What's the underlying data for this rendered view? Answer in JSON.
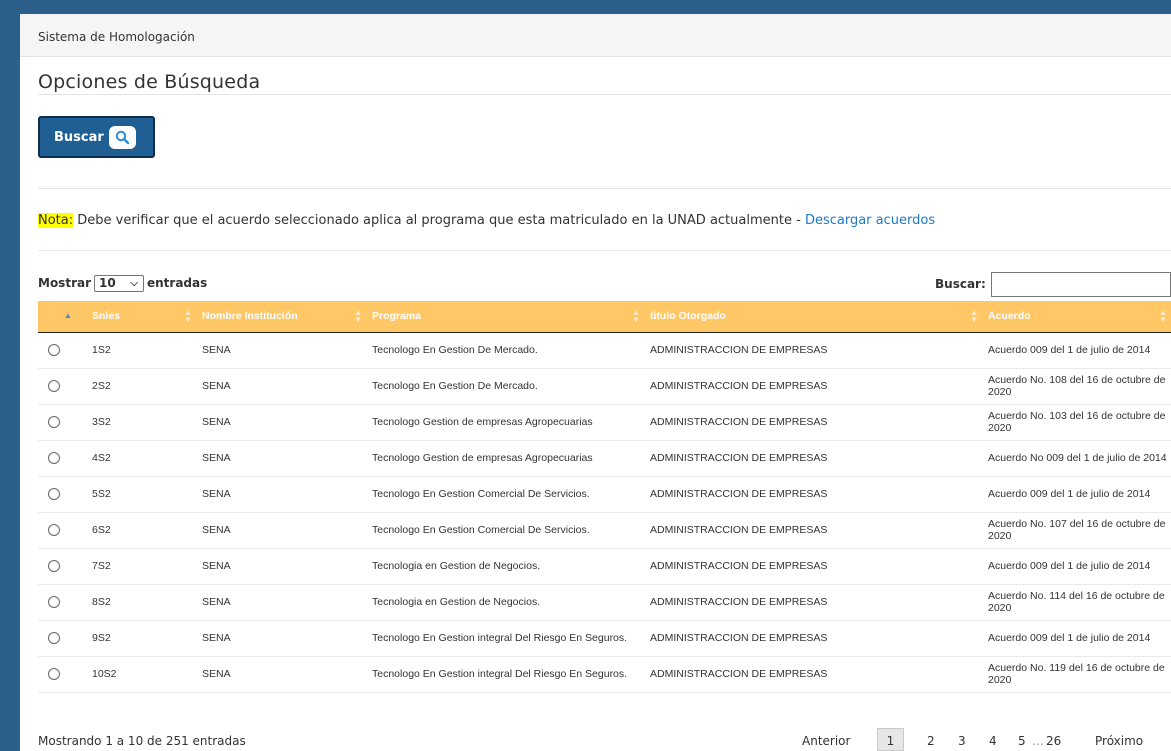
{
  "breadcrumb": "Sistema de Homologación",
  "page_title": "Opciones de Búsqueda",
  "search_button_label": "Buscar",
  "nota": {
    "tag": "Nota:",
    "text": " Debe verificar que el acuerdo seleccionado aplica al programa que esta matriculado en la UNAD actualmente - ",
    "link": "Descargar acuerdos"
  },
  "length_control": {
    "prefix": "Mostrar",
    "value": "10",
    "suffix": "entradas"
  },
  "filter": {
    "label": "Buscar:",
    "value": ""
  },
  "table": {
    "columns": [
      "Snies",
      "Nombre Institución",
      "Programa",
      "titulo Otorgado",
      "Acuerdo"
    ],
    "rows": [
      {
        "snies": "1S2",
        "institucion": "SENA",
        "programa": "Tecnologo En Gestion De Mercado.",
        "titulo": "ADMINISTRACCION DE EMPRESAS",
        "acuerdo": "Acuerdo 009 del 1 de julio de 2014"
      },
      {
        "snies": "2S2",
        "institucion": "SENA",
        "programa": "Tecnologo En Gestion De Mercado.",
        "titulo": "ADMINISTRACCION DE EMPRESAS",
        "acuerdo": "Acuerdo No. 108 del 16 de octubre de 2020"
      },
      {
        "snies": "3S2",
        "institucion": "SENA",
        "programa": "Tecnologo Gestion de empresas Agropecuarias",
        "titulo": "ADMINISTRACCION DE EMPRESAS",
        "acuerdo": "Acuerdo No. 103 del 16 de octubre de 2020"
      },
      {
        "snies": "4S2",
        "institucion": "SENA",
        "programa": "Tecnologo Gestion de empresas Agropecuarias",
        "titulo": "ADMINISTRACCION DE EMPRESAS",
        "acuerdo": "Acuerdo No 009 del 1 de julio de 2014"
      },
      {
        "snies": "5S2",
        "institucion": "SENA",
        "programa": "Tecnologo En Gestion Comercial De Servicios.",
        "titulo": "ADMINISTRACCION DE EMPRESAS",
        "acuerdo": "Acuerdo 009 del 1 de julio de 2014"
      },
      {
        "snies": "6S2",
        "institucion": "SENA",
        "programa": "Tecnologo En Gestion Comercial De Servicios.",
        "titulo": "ADMINISTRACCION DE EMPRESAS",
        "acuerdo": "Acuerdo No. 107 del 16 de octubre de 2020"
      },
      {
        "snies": "7S2",
        "institucion": "SENA",
        "programa": "Tecnologia en Gestion de Negocios.",
        "titulo": "ADMINISTRACCION DE EMPRESAS",
        "acuerdo": "Acuerdo 009 del 1 de julio de 2014"
      },
      {
        "snies": "8S2",
        "institucion": "SENA",
        "programa": "Tecnologia en Gestion de Negocios.",
        "titulo": "ADMINISTRACCION DE EMPRESAS",
        "acuerdo": "Acuerdo No. 114 del 16 de octubre de 2020"
      },
      {
        "snies": "9S2",
        "institucion": "SENA",
        "programa": "Tecnologo En Gestion integral Del Riesgo En Seguros.",
        "titulo": "ADMINISTRACCION DE EMPRESAS",
        "acuerdo": "Acuerdo 009 del 1 de julio de 2014"
      },
      {
        "snies": "10S2",
        "institucion": "SENA",
        "programa": "Tecnologo En Gestion integral Del Riesgo En Seguros.",
        "titulo": "ADMINISTRACCION DE EMPRESAS",
        "acuerdo": "Acuerdo No. 119 del 16 de octubre de 2020"
      }
    ]
  },
  "info": "Mostrando 1 a 10 de 251 entradas",
  "pagination": {
    "previous": "Anterior",
    "current": "1",
    "pages": [
      "2",
      "3",
      "4",
      "5"
    ],
    "ellipsis": "…",
    "last": "26",
    "next": "Próximo"
  },
  "colors": {
    "frame": "#2c5f8a",
    "header": "#ffc766",
    "button": "#1f5f93",
    "link": "#1a7ac9",
    "highlight": "#ffff00"
  }
}
